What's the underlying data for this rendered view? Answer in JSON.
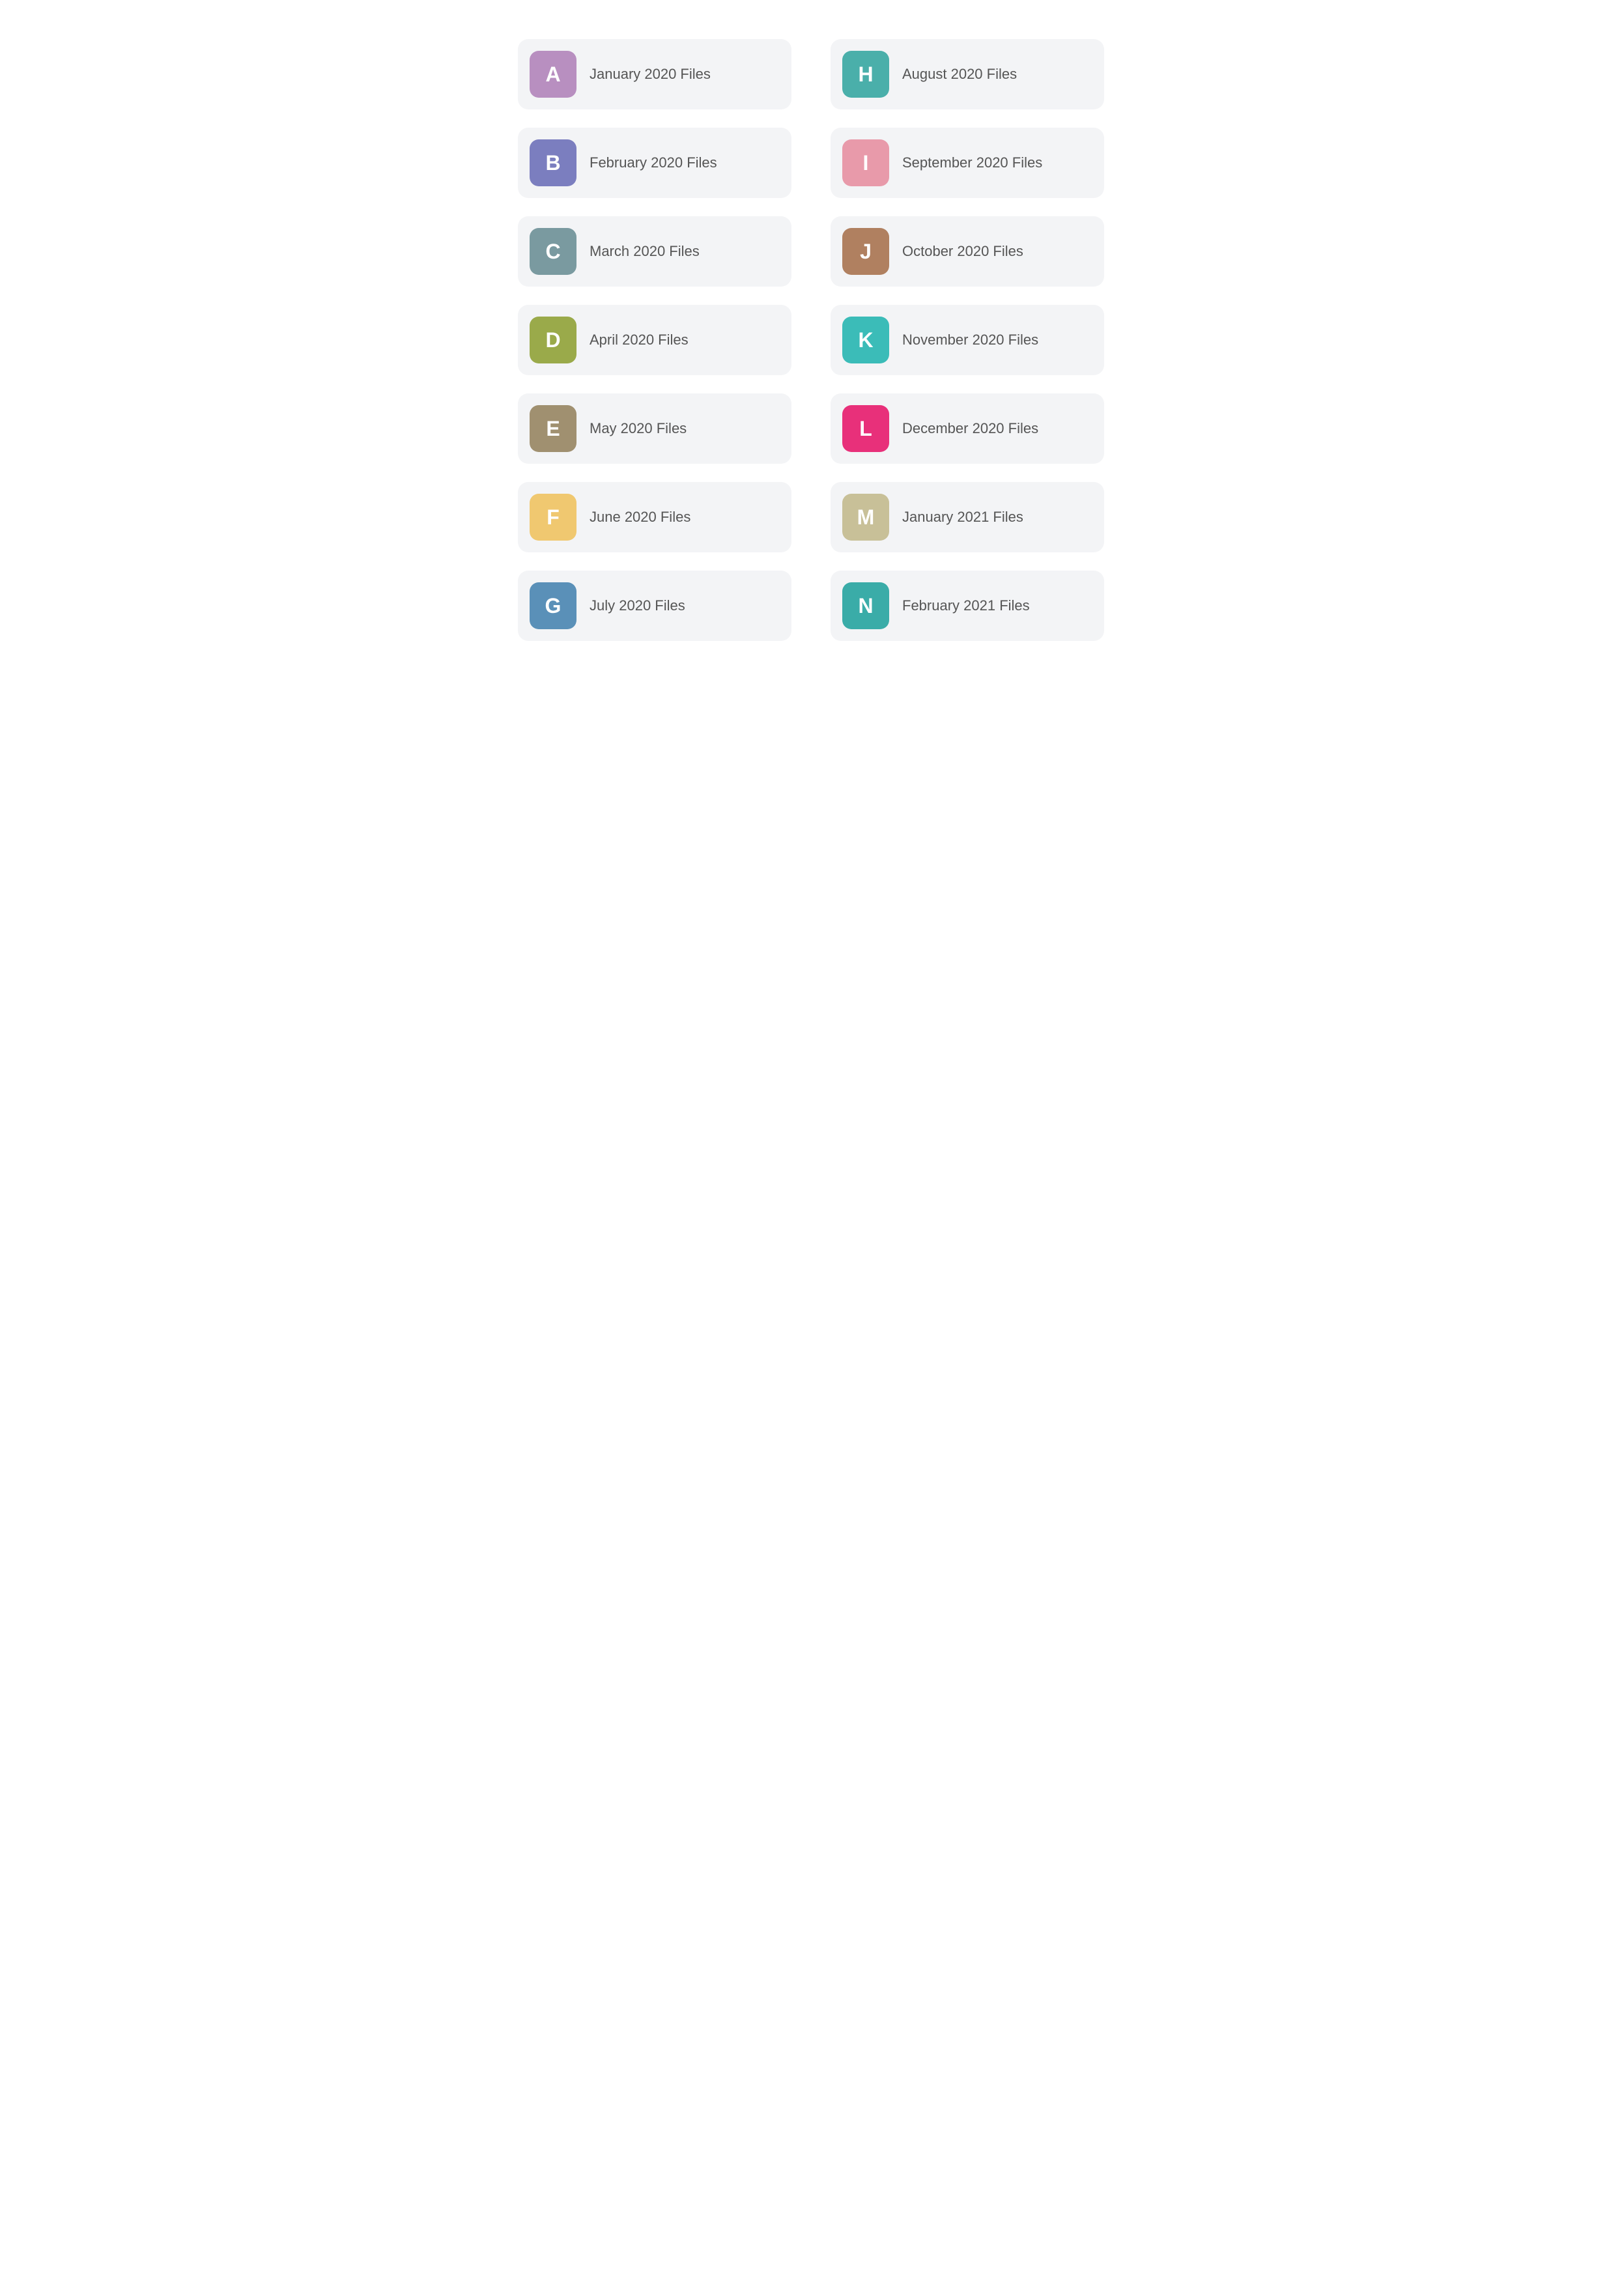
{
  "folders": [
    {
      "id": "a",
      "letter": "A",
      "label": "January 2020 Files",
      "color": "#b88fc0"
    },
    {
      "id": "h",
      "letter": "H",
      "label": "August 2020 Files",
      "color": "#4aafaa"
    },
    {
      "id": "b",
      "letter": "B",
      "label": "February 2020 Files",
      "color": "#7b7ebf"
    },
    {
      "id": "i",
      "letter": "I",
      "label": "September 2020 Files",
      "color": "#e89aaa"
    },
    {
      "id": "c",
      "letter": "C",
      "label": "March 2020 Files",
      "color": "#7a9aa0"
    },
    {
      "id": "j",
      "letter": "J",
      "label": "October 2020 Files",
      "color": "#b08060"
    },
    {
      "id": "d",
      "letter": "D",
      "label": "April 2020 Files",
      "color": "#9aaa4a"
    },
    {
      "id": "k",
      "letter": "K",
      "label": "November 2020 Files",
      "color": "#3bbcb8"
    },
    {
      "id": "e",
      "letter": "E",
      "label": "May 2020 Files",
      "color": "#a09070"
    },
    {
      "id": "l",
      "letter": "L",
      "label": "December 2020 Files",
      "color": "#e8307a"
    },
    {
      "id": "f",
      "letter": "F",
      "label": "June 2020 Files",
      "color": "#f0c870"
    },
    {
      "id": "m",
      "letter": "M",
      "label": "January 2021 Files",
      "color": "#c8c098"
    },
    {
      "id": "g",
      "letter": "G",
      "label": "July 2020 Files",
      "color": "#5a90b8"
    },
    {
      "id": "n",
      "letter": "N",
      "label": "February 2021 Files",
      "color": "#3aaca8"
    }
  ]
}
